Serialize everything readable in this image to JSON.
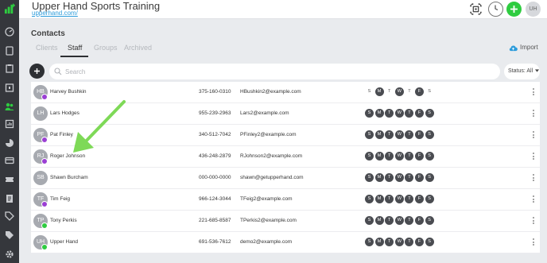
{
  "header": {
    "title": "Upper Hand Sports Training",
    "url": "upperhand.com/",
    "avatar_initials": "UH"
  },
  "colors": {
    "sidebar": "#35373c",
    "accent_green": "#2ecc40",
    "link_blue": "#2d9cdb",
    "badge_purple": "#9b3fd4",
    "badge_green": "#2ecc40",
    "day_on": "#4a4c51"
  },
  "sidebar": {
    "items": [
      {
        "icon": "dashboard-icon"
      },
      {
        "icon": "book-icon"
      },
      {
        "icon": "clipboard-icon"
      },
      {
        "icon": "calendar-icon"
      },
      {
        "icon": "contacts-icon",
        "active": true
      },
      {
        "icon": "reports-icon"
      },
      {
        "icon": "pie-chart-icon"
      },
      {
        "icon": "card-icon"
      },
      {
        "icon": "ticket-icon"
      },
      {
        "icon": "invoice-icon"
      },
      {
        "icon": "tag-icon"
      },
      {
        "icon": "tags-icon"
      },
      {
        "icon": "settings-icon"
      }
    ]
  },
  "page": {
    "title": "Contacts",
    "tabs": [
      "Clients",
      "Staff",
      "Groups",
      "Archived"
    ],
    "active_tab": "Staff",
    "import_label": "Import"
  },
  "search": {
    "placeholder": "Search",
    "status_label": "Status: All"
  },
  "staff": [
    {
      "initials": "HB",
      "name": "Harvey Bushkin",
      "phone": "375-160-0310",
      "email": "HBushkin2@example.com",
      "badge": "purple",
      "days": [
        false,
        true,
        false,
        true,
        false,
        true,
        false
      ]
    },
    {
      "initials": "LH",
      "name": "Lars Hodges",
      "phone": "955-239-2963",
      "email": "Lars2@example.com",
      "badge": "none",
      "days": [
        true,
        true,
        true,
        true,
        true,
        true,
        true
      ]
    },
    {
      "initials": "PF",
      "name": "Pat Finley",
      "phone": "340-512-7042",
      "email": "PFinley2@example.com",
      "badge": "purple",
      "days": [
        true,
        true,
        true,
        true,
        true,
        true,
        true
      ]
    },
    {
      "initials": "RJ",
      "name": "Roger Johnson",
      "phone": "436-248-2879",
      "email": "RJohnson2@example.com",
      "badge": "purple",
      "days": [
        true,
        true,
        true,
        true,
        true,
        true,
        true
      ]
    },
    {
      "initials": "SB",
      "name": "Shawn Burcham",
      "phone": "000-000-0000",
      "email": "shawn@getupperhand.com",
      "badge": "none",
      "days": [
        true,
        true,
        true,
        true,
        true,
        true,
        true
      ]
    },
    {
      "initials": "TF",
      "name": "Tim Feig",
      "phone": "966-124-3044",
      "email": "TFeig2@example.com",
      "badge": "purple",
      "days": [
        true,
        true,
        true,
        true,
        true,
        true,
        true
      ]
    },
    {
      "initials": "TP",
      "name": "Tony Perkis",
      "phone": "221-685-8587",
      "email": "TPerkis2@example.com",
      "badge": "green",
      "days": [
        true,
        true,
        true,
        true,
        true,
        true,
        true
      ]
    },
    {
      "initials": "UH",
      "name": "Upper Hand",
      "phone": "691-536-7612",
      "email": "demo2@example.com",
      "badge": "green",
      "days": [
        true,
        true,
        true,
        true,
        true,
        true,
        true
      ]
    }
  ],
  "day_letters": [
    "S",
    "M",
    "T",
    "W",
    "T",
    "F",
    "S"
  ]
}
